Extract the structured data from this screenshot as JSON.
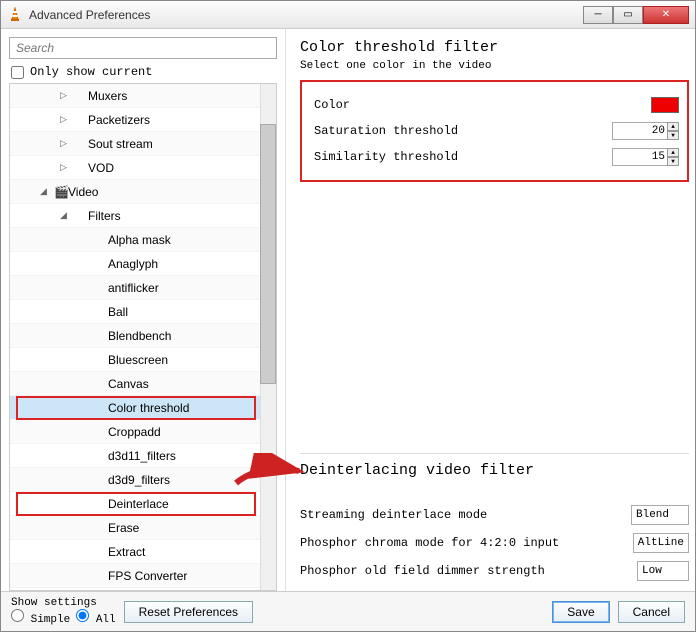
{
  "window": {
    "title": "Advanced Preferences"
  },
  "search": {
    "placeholder": "Search"
  },
  "only_show_current": "Only show current",
  "tree": {
    "items": [
      {
        "label": "Muxers",
        "indent": 2,
        "arrow": "▷"
      },
      {
        "label": "Packetizers",
        "indent": 2,
        "arrow": "▷"
      },
      {
        "label": "Sout stream",
        "indent": 2,
        "arrow": "▷"
      },
      {
        "label": "VOD",
        "indent": 2,
        "arrow": "▷"
      },
      {
        "label": "Video",
        "indent": 1,
        "arrow": "◢",
        "icon": "🎬"
      },
      {
        "label": "Filters",
        "indent": 2,
        "arrow": "◢"
      },
      {
        "label": "Alpha mask",
        "indent": 3
      },
      {
        "label": "Anaglyph",
        "indent": 3
      },
      {
        "label": "antiflicker",
        "indent": 3
      },
      {
        "label": "Ball",
        "indent": 3
      },
      {
        "label": "Blendbench",
        "indent": 3
      },
      {
        "label": "Bluescreen",
        "indent": 3
      },
      {
        "label": "Canvas",
        "indent": 3
      },
      {
        "label": "Color threshold",
        "indent": 3,
        "selected": true,
        "hl": true
      },
      {
        "label": "Croppadd",
        "indent": 3
      },
      {
        "label": "d3d11_filters",
        "indent": 3
      },
      {
        "label": "d3d9_filters",
        "indent": 3
      },
      {
        "label": "Deinterlace",
        "indent": 3,
        "hl": true
      },
      {
        "label": "Erase",
        "indent": 3
      },
      {
        "label": "Extract",
        "indent": 3
      },
      {
        "label": "FPS Converter",
        "indent": 3
      }
    ]
  },
  "color_threshold": {
    "title": "Color threshold filter",
    "subtitle": "Select one color in the video",
    "color_label": "Color",
    "color_value": "#ee0000",
    "sat_label": "Saturation threshold",
    "sat_value": "20",
    "sim_label": "Similarity threshold",
    "sim_value": "15"
  },
  "deinterlace": {
    "title": "Deinterlacing video filter",
    "mode_label": "Streaming deinterlace mode",
    "mode_value": "Blend",
    "phosphor_label": "Phosphor chroma mode for 4:2:0 input",
    "phosphor_value": "AltLine",
    "dimmer_label": "Phosphor old field dimmer strength",
    "dimmer_value": "Low"
  },
  "footer": {
    "show_settings": "Show settings",
    "simple": "Simple",
    "all": "All",
    "reset": "Reset Preferences",
    "save": "Save",
    "cancel": "Cancel"
  }
}
